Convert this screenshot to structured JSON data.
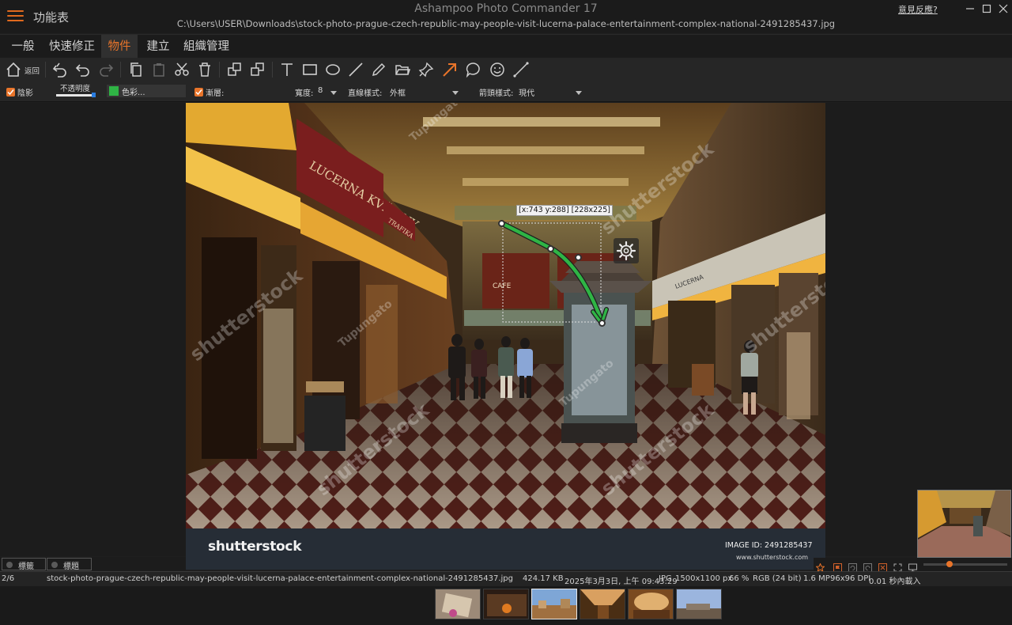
{
  "window": {
    "menu_label": "功能表",
    "app_title": "Ashampoo Photo Commander 17",
    "file_path": "C:\\Users\\USER\\Downloads\\stock-photo-prague-czech-republic-may-people-visit-lucerna-palace-entertainment-complex-national-2491285437.jpg",
    "feedback_link": "意見反應?",
    "controls": [
      "minimize-icon",
      "maximize-icon",
      "close-icon"
    ]
  },
  "tabs": [
    {
      "label": "一般",
      "active": false
    },
    {
      "label": "快速修正",
      "active": false
    },
    {
      "label": "物件",
      "active": true
    },
    {
      "label": "建立",
      "active": false
    },
    {
      "label": "組織管理",
      "active": false
    }
  ],
  "toolbar": {
    "back_label": "返回",
    "tools": [
      "home-icon",
      "undo-all-icon",
      "undo-icon",
      "redo-icon",
      "copy-icon",
      "paste-icon",
      "cut-icon",
      "delete-icon",
      "bring-forward-icon",
      "send-backward-icon",
      "text-tool-icon",
      "rectangle-tool-icon",
      "ellipse-tool-icon",
      "line-tool-icon",
      "pencil-tool-icon",
      "open-folder-icon",
      "pin-tool-icon",
      "arrow-tool-icon",
      "speech-bubble-icon",
      "smiley-icon",
      "pen-line-icon"
    ],
    "active_tool": "arrow-tool-icon"
  },
  "options": {
    "shadow_label": "陰影",
    "shadow_checked": true,
    "opacity_label": "不透明度",
    "opacity_value": 0.95,
    "color_label": "色彩...",
    "color_value": "#2fb445",
    "gradient_label": "漸層:",
    "gradient_checked": true,
    "width_label": "寬度:",
    "width_value": "8",
    "line_style_label": "直線樣式:",
    "line_style_value": "外框",
    "arrow_style_label": "箭頭樣式:",
    "arrow_style_value": "現代"
  },
  "canvas": {
    "coord_readout": "[x:743 y:288] [228x225]",
    "watermark_logo": "shutterstock",
    "image_id": "IMAGE ID: 2491285437",
    "watermark_url": "www.shutterstock.com",
    "watermark_texts": [
      "shutterstock",
      "Tupungato"
    ],
    "sign_texts": [
      "LUCERNA KVĚTINY",
      "CAFE",
      "TRAFIKA",
      "LUCERNA"
    ]
  },
  "bottom_tabs": {
    "tag_label": "標籤",
    "title_label": "標題"
  },
  "status": {
    "index": "2/6",
    "filename": "stock-photo-prague-czech-republic-may-people-visit-lucerna-palace-entertainment-complex-national-2491285437.jpg",
    "filesize": "424.17 KB",
    "date": "2025年3月3日, 上午 09:43:29",
    "format": "JPG",
    "dimensions": "1500x1100 px",
    "zoom": "66 %",
    "color_mode": "RGB (24 bit)",
    "megapixels": "1.6 MP",
    "dpi": "96x96 DPI",
    "load_time": "0.01 秒內載入"
  },
  "rating_icons": [
    "star-icon",
    "flag-icon",
    "rotate-left-icon",
    "rotate-right-icon",
    "compare-icon",
    "fullscreen-icon",
    "monitor-icon"
  ],
  "zoom_slider": 0.3,
  "filmstrip": [
    {
      "name": "thumb-1",
      "colors": [
        "#c9b8a0",
        "#8a6a4a"
      ]
    },
    {
      "name": "thumb-2",
      "colors": [
        "#3a2a20",
        "#b46a2a"
      ]
    },
    {
      "name": "thumb-3",
      "colors": [
        "#7ea6d6",
        "#a07040"
      ]
    },
    {
      "name": "thumb-4",
      "colors": [
        "#5a3a1a",
        "#d9a060"
      ]
    },
    {
      "name": "thumb-5",
      "colors": [
        "#8a5a2a",
        "#e0b070"
      ]
    },
    {
      "name": "thumb-6",
      "colors": [
        "#9bb5de",
        "#6a5a4a"
      ]
    }
  ]
}
